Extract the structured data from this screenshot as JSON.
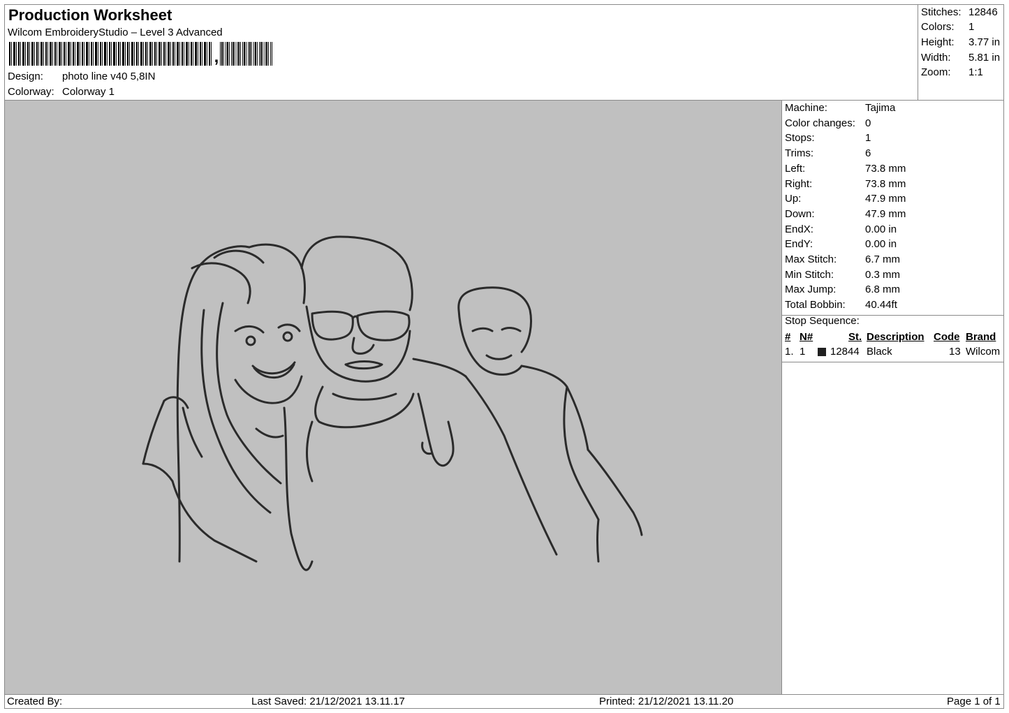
{
  "header": {
    "title": "Production Worksheet",
    "subtitle": "Wilcom EmbroideryStudio – Level 3 Advanced",
    "design_label": "Design:",
    "design_value": "photo line v40 5,8IN",
    "colorway_label": "Colorway:",
    "colorway_value": "Colorway 1"
  },
  "stats": {
    "stitches_label": "Stitches:",
    "stitches_value": "12846",
    "colors_label": "Colors:",
    "colors_value": "1",
    "height_label": "Height:",
    "height_value": "3.77 in",
    "width_label": "Width:",
    "width_value": "5.81 in",
    "zoom_label": "Zoom:",
    "zoom_value": "1:1"
  },
  "machine": {
    "rows": [
      {
        "label": "Machine:",
        "value": "Tajima"
      },
      {
        "label": "Color changes:",
        "value": "0"
      },
      {
        "label": "Stops:",
        "value": "1"
      },
      {
        "label": "Trims:",
        "value": "6"
      },
      {
        "label": "Left:",
        "value": "73.8 mm"
      },
      {
        "label": "Right:",
        "value": "73.8 mm"
      },
      {
        "label": "Up:",
        "value": "47.9 mm"
      },
      {
        "label": "Down:",
        "value": "47.9 mm"
      },
      {
        "label": "EndX:",
        "value": "0.00 in"
      },
      {
        "label": "EndY:",
        "value": "0.00 in"
      },
      {
        "label": "Max Stitch:",
        "value": "6.7 mm"
      },
      {
        "label": "Min Stitch:",
        "value": "0.3 mm"
      },
      {
        "label": "Max Jump:",
        "value": "6.8 mm"
      },
      {
        "label": "Total Bobbin:",
        "value": "40.44ft"
      }
    ]
  },
  "stop_sequence": {
    "title": "Stop Sequence:",
    "headers": [
      "#",
      "N#",
      "St.",
      "Description",
      "Code",
      "Brand"
    ],
    "rows": [
      {
        "index": "1.",
        "n": "1",
        "stitches": "12844",
        "description": "Black",
        "code": "13",
        "brand": "Wilcom",
        "color": "#202020"
      }
    ]
  },
  "design_colors": {
    "thread": "#2b2b2b",
    "background": "#c0c0c0"
  },
  "footer": {
    "created_by": "Created By:",
    "last_saved": "Last Saved: 21/12/2021 13.11.17",
    "printed": "Printed: 21/12/2021 13.11.20",
    "page": "Page 1 of 1"
  }
}
